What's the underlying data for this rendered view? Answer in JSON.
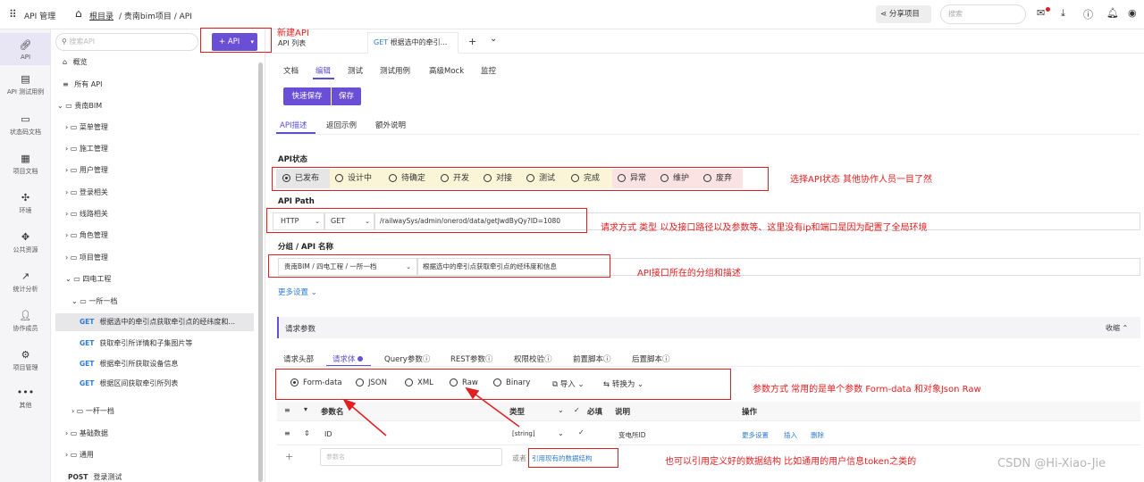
{
  "app": {
    "title": "API 管理",
    "breadcrumb_home": "根目录",
    "breadcrumb_path": "/ 贵南bim项目 / API"
  },
  "header": {
    "share_label": "分享项目",
    "search_placeholder": "搜索"
  },
  "leftnav": [
    {
      "label": "API",
      "icon": "link-icon"
    },
    {
      "label": "API 测试用例",
      "icon": "clipboard-icon"
    },
    {
      "label": "状态码文档",
      "icon": "doc-icon"
    },
    {
      "label": "项目文档",
      "icon": "book-icon"
    },
    {
      "label": "环境",
      "icon": "environment-icon"
    },
    {
      "label": "公共资源",
      "icon": "resource-icon"
    },
    {
      "label": "统计分析",
      "icon": "chart-icon"
    },
    {
      "label": "协作成员",
      "icon": "user-icon"
    },
    {
      "label": "项目管理",
      "icon": "settings-icon"
    },
    {
      "label": "其他",
      "icon": "more-icon"
    }
  ],
  "sidebar": {
    "search_placeholder": "搜索API",
    "add_api_label": "+ API",
    "overview": "概览",
    "all_api": "所有 API",
    "root": "贵南BIM",
    "groups": [
      "菜单管理",
      "施工管理",
      "用户管理",
      "登录相关",
      "线路相关",
      "角色管理",
      "项目管理",
      "四电工程"
    ],
    "subgroup": "一所一档",
    "apis": [
      {
        "method": "GET",
        "name": "根据选中的牵引点获取牵引点的经纬度和..."
      },
      {
        "method": "GET",
        "name": "获取牵引所详情和子集图片等"
      },
      {
        "method": "GET",
        "name": "根据牵引所获取设备信息"
      },
      {
        "method": "GET",
        "name": "根据区间获取牵引所列表"
      }
    ],
    "subgroup2": "一杆一档",
    "groups2": [
      "基础数据",
      "通用"
    ],
    "post_api": {
      "method": "POST",
      "name": "登录测试"
    }
  },
  "tabs": {
    "list": "API 列表",
    "current_method": "GET",
    "current": "根据选中的牵引...",
    "plus": "+",
    "more": "⌄"
  },
  "subtabs": [
    "文档",
    "编辑",
    "测试",
    "测试用例",
    "高级Mock",
    "监控"
  ],
  "actions": {
    "quick_save": "快速保存",
    "save": "保存"
  },
  "desc_tabs": [
    "API描述",
    "返回示例",
    "额外说明"
  ],
  "status": {
    "label": "API状态",
    "options": [
      "已发布",
      "设计中",
      "待确定",
      "开发",
      "对接",
      "测试",
      "完成",
      "异常",
      "维护",
      "废弃"
    ]
  },
  "path": {
    "label": "API Path",
    "protocol": "HTTP",
    "method": "GET",
    "url": "/railwaySys/admin/onerod/data/getJwdByQy?ID=1080"
  },
  "group": {
    "label": "分组 / API 名称",
    "value": "贵南BIM / 四电工程 / 一所一档",
    "name": "根据选中的牵引点获取牵引点的经纬度和信息"
  },
  "more_settings": "更多设置",
  "params": {
    "title": "请求参数",
    "collapse": "收缩",
    "tabs": [
      "请求头部",
      "请求体",
      "Query参数",
      "REST参数",
      "权限校验",
      "前置脚本",
      "后置脚本"
    ]
  },
  "body_types": [
    "Form-data",
    "JSON",
    "XML",
    "Raw",
    "Binary"
  ],
  "body_tools": {
    "import": "导入",
    "convert": "转换为"
  },
  "table": {
    "headers": [
      "参数名",
      "类型",
      "必填",
      "说明",
      "操作"
    ],
    "row": {
      "name": "ID",
      "type": "[string]",
      "desc": "变电所ID",
      "ops": [
        "更多设置",
        "插入",
        "删除"
      ]
    },
    "new_placeholder": "参数名",
    "or": "或者",
    "ref": "引用现有的数据结构"
  },
  "annotations": {
    "new_api": "新建API",
    "status": "选择API状态  其他协作人员一目了然",
    "path": "请求方式 类型 以及接口路径以及参数等、这里没有ip和端口是因为配置了全局环境",
    "group": "API接口所在的分组和描述",
    "body": "参数方式  常用的是单个参数 Form-data 和对象Json Raw",
    "ref": "也可以引用定义好的数据结构  比如通用的用户信息token之类的"
  },
  "watermark": "CSDN @Hi-Xiao-Jie"
}
